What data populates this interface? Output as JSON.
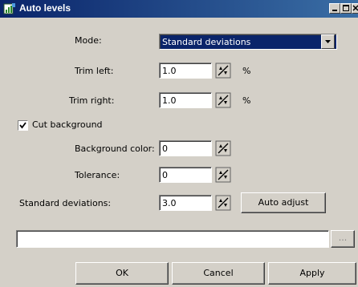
{
  "title": "Auto levels",
  "mode": {
    "label": "Mode:",
    "value": "Standard deviations"
  },
  "trim_left": {
    "label": "Trim left:",
    "value": "1.0",
    "unit": "%"
  },
  "trim_right": {
    "label": "Trim right:",
    "value": "1.0",
    "unit": "%"
  },
  "cut_background": {
    "label": "Cut background",
    "checked": true
  },
  "background_color": {
    "label": "Background color:",
    "value": "0"
  },
  "tolerance": {
    "label": "Tolerance:",
    "value": "0"
  },
  "std_dev": {
    "label": "Standard deviations:",
    "value": "3.0"
  },
  "auto_adjust_label": "Auto adjust",
  "path": {
    "value": "",
    "browse_label": "..."
  },
  "buttons": {
    "ok": "OK",
    "cancel": "Cancel",
    "apply": "Apply"
  }
}
